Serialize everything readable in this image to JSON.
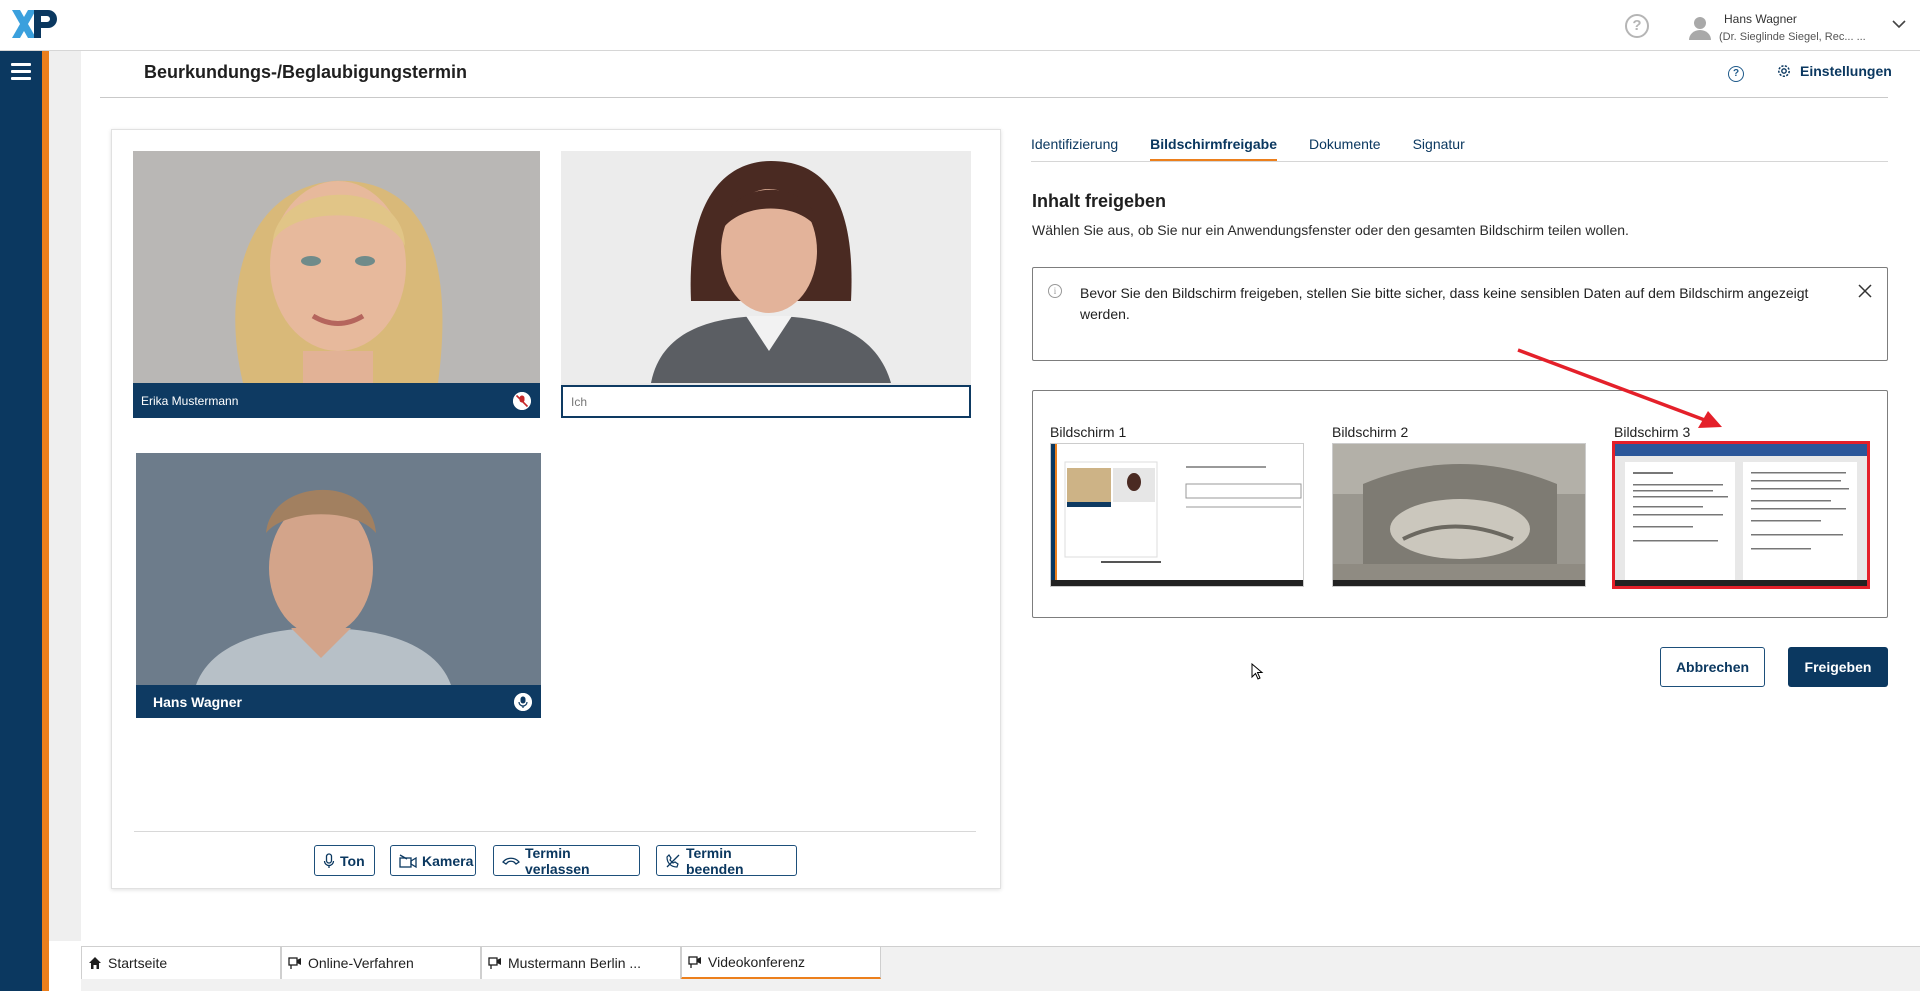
{
  "header": {
    "logo_text": "XP",
    "help_symbol": "?",
    "user_name": "Hans Wagner",
    "user_org": "(Dr. Sieglinde Siegel, Rec...   ...",
    "page_title": "Beurkundungs-/Beglaubigungstermin",
    "settings_label": "Einstellungen"
  },
  "participants": [
    {
      "name": "Erika Mustermann",
      "muted": true
    },
    {
      "name": "Ich",
      "muted": false
    },
    {
      "name": "Hans Wagner",
      "muted": false
    }
  ],
  "controls": {
    "audio_label": "Ton",
    "camera_label": "Kamera",
    "leave_label": "Termin verlassen",
    "end_label": "Termin beenden"
  },
  "tabs": [
    {
      "label": "Identifizierung",
      "active": false
    },
    {
      "label": "Bildschirmfreigabe",
      "active": true
    },
    {
      "label": "Dokumente",
      "active": false
    },
    {
      "label": "Signatur",
      "active": false
    }
  ],
  "share": {
    "title": "Inhalt freigeben",
    "description": "Wählen Sie aus, ob Sie nur ein Anwendungsfenster oder den gesamten Bildschirm teilen wollen.",
    "info_symbol": "i",
    "info_text": "Bevor Sie den Bildschirm freigeben, stellen Sie bitte sicher, dass keine sensiblen Daten auf dem Bildschirm angezeigt werden.",
    "screens": [
      {
        "label": "Bildschirm 1",
        "selected": false
      },
      {
        "label": "Bildschirm 2",
        "selected": false
      },
      {
        "label": "Bildschirm 3",
        "selected": true
      }
    ],
    "cancel_label": "Abbrechen",
    "confirm_label": "Freigeben"
  },
  "taskbar": [
    {
      "label": "Startseite",
      "icon": "home-icon",
      "active": false
    },
    {
      "label": "Online-Verfahren",
      "icon": "video-call-icon",
      "active": false
    },
    {
      "label": "Mustermann Berlin ...",
      "icon": "video-call-icon",
      "active": false
    },
    {
      "label": "Videokonferenz",
      "icon": "video-call-icon",
      "active": true
    }
  ],
  "colors": {
    "brand_navy": "#0b3860",
    "accent_orange": "#ec7f1c",
    "selection_red": "#e4202a"
  }
}
